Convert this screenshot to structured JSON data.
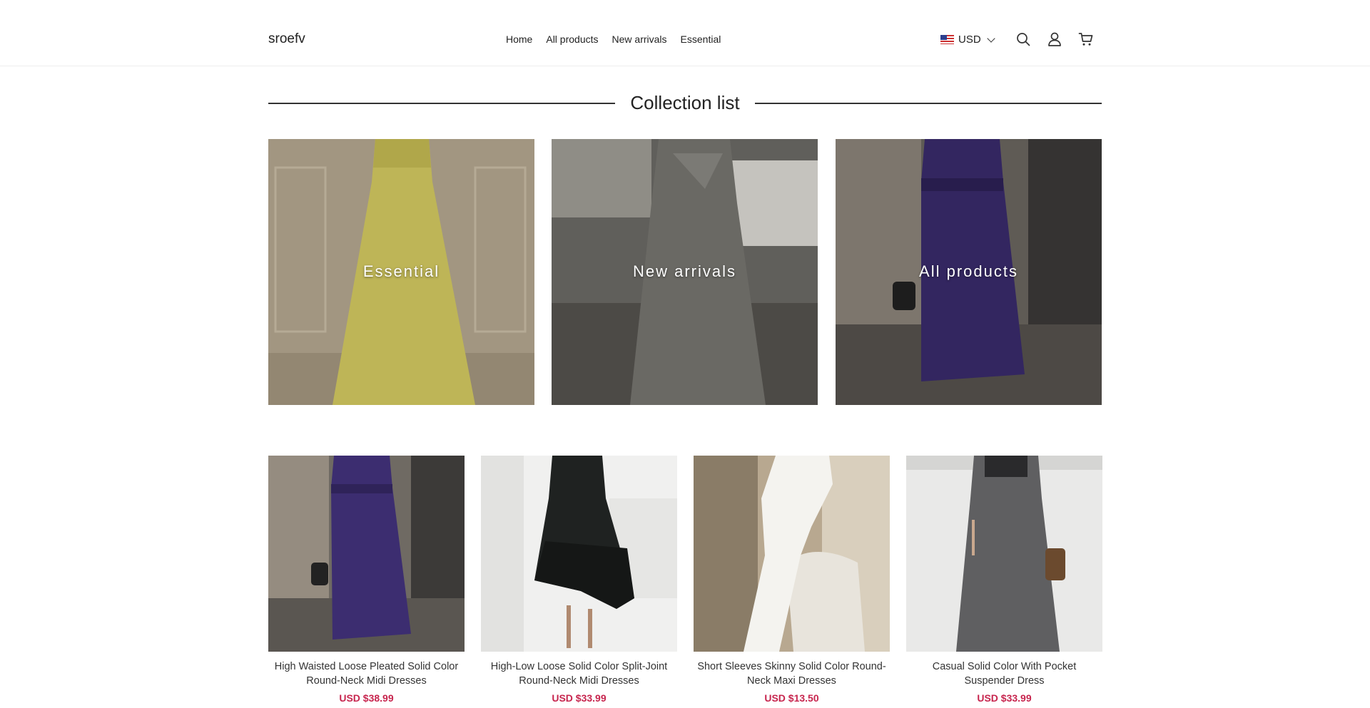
{
  "header": {
    "logo": "sroefv",
    "nav": [
      "Home",
      "All products",
      "New arrivals",
      "Essential"
    ],
    "currency": "USD",
    "icons": [
      "search-icon",
      "account-icon",
      "cart-icon"
    ]
  },
  "collection": {
    "title": "Collection list",
    "tiles": [
      {
        "label": "Essential",
        "bg": "#b8a890",
        "dress": "#e0d46a"
      },
      {
        "label": "New arrivals",
        "bg": "#5f5d58",
        "dress": "#6f6e69"
      },
      {
        "label": "All products",
        "bg": "#5a5650",
        "dress": "#3a2a6a"
      }
    ]
  },
  "products": [
    {
      "name": "High Waisted Loose Pleated Solid Color Round-Neck Midi Dresses",
      "price": "USD $38.99"
    },
    {
      "name": "High-Low Loose Solid Color Split-Joint Round-Neck Midi Dresses",
      "price": "USD $33.99"
    },
    {
      "name": "Short Sleeves Skinny Solid Color Round-Neck Maxi Dresses",
      "price": "USD $13.50"
    },
    {
      "name": "Casual Solid Color With Pocket Suspender Dress",
      "price": "USD $33.99"
    }
  ],
  "colors": {
    "price": "#c7254e",
    "text": "#222222"
  }
}
